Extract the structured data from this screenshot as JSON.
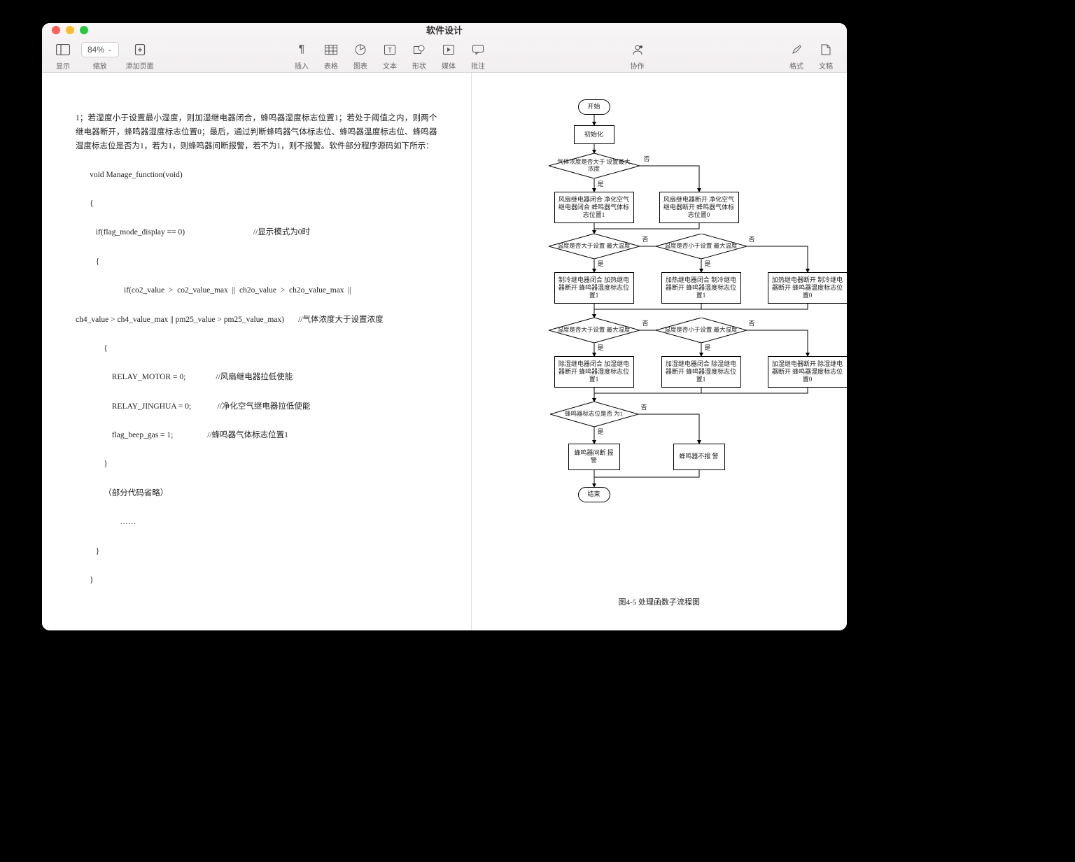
{
  "window": {
    "title": "软件设计"
  },
  "toolbar": {
    "view_label": "显示",
    "zoom_label": "缩放",
    "zoom_value": "84%",
    "add_page_label": "添加页面",
    "insert_label": "插入",
    "table_label": "表格",
    "chart_label": "图表",
    "text_label": "文本",
    "shape_label": "形状",
    "media_label": "媒体",
    "comment_label": "批注",
    "collab_label": "协作",
    "format_label": "格式",
    "document_label": "文稿"
  },
  "left_page": {
    "para": "1；若湿度小于设置最小湿度，则加湿继电器闭合，蜂鸣器湿度标志位置1；若处于阈值之内，则两个继电器断开，蜂鸣器湿度标志位置0；最后，通过判断蜂鸣器气体标志位、蜂鸣器温度标志位、蜂鸣器湿度标志位是否为1，若为1，则蜂鸣器间断报警，若不为1，则不报警。软件部分程序源码如下所示：",
    "code": {
      "l1": "       void Manage_function(void)",
      "l2": "       {",
      "l3": "          if(flag_mode_display == 0)                                  //显示模式为0时",
      "l4": "          {",
      "l5": "                        if(co2_value  >  co2_value_max  ||  ch2o_value  >  ch2o_value_max  ||",
      "l6": "ch4_value > ch4_value_max || pm25_value > pm25_value_max)       //气体浓度大于设置浓度",
      "l7": "              {",
      "l8": "                  RELAY_MOTOR = 0;               //风扇继电器拉低使能",
      "l9": "                  RELAY_JINGHUA = 0;             //净化空气继电器拉低使能",
      "l10": "                  flag_beep_gas = 1;                 //蜂鸣器气体标志位置1",
      "l11": "              }",
      "l12": "              （部分代码省略）",
      "l13": "                      ……",
      "l14": "          }",
      "l15": "       }"
    }
  },
  "right_page": {
    "caption": "图4-5  处理函数子流程图",
    "nodes": {
      "start": "开始",
      "init": "初始化",
      "d_gas": "气体浓度是否大于\n设置最大浓度",
      "gas_yes": "风扇继电器闭合\n净化空气继电器闭合\n蜂鸣器气体标志位置1",
      "gas_no": "风扇继电器断开\n净化空气继电器断开\n蜂鸣器气体标志位置0",
      "d_temp_high": "温度是否大于设置\n最大温度",
      "d_temp_low": "温度是否小于设置\n最大温度",
      "temp_a": "制冷继电器闭合\n加热继电器断开\n蜂鸣器温度标志位置1",
      "temp_b": "加热继电器闭合\n制冷继电器断开\n蜂鸣器温度标志位置1",
      "temp_c": "加热继电器断开\n制冷继电器断开\n蜂鸣器温度标志位置0",
      "d_hum_high": "湿度是否大于设置\n最大湿度",
      "d_hum_low": "湿度是否小于设置\n最大湿度",
      "hum_a": "除湿继电器闭合\n加湿继电器断开\n蜂鸣器湿度标志位置1",
      "hum_b": "加湿继电器闭合\n除湿继电器断开\n蜂鸣器湿度标志位置1",
      "hum_c": "加湿继电器断开\n除湿继电器断开\n蜂鸣器湿度标志位置0",
      "d_beep": "蜂鸣器标志位是否\n为1",
      "beep_yes": "蜂鸣器间断\n报警",
      "beep_no": "蜂鸣器不报\n警",
      "end": "结束"
    },
    "labels": {
      "yes": "是",
      "no": "否"
    }
  }
}
